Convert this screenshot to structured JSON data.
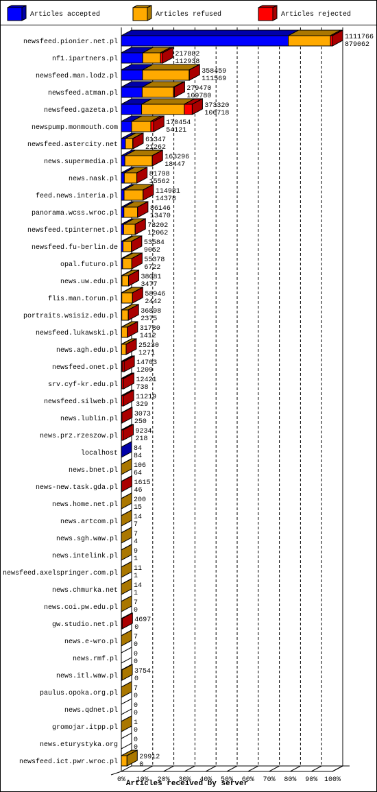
{
  "chart_data": {
    "type": "bar",
    "orientation": "horizontal-stacked-3d",
    "xlabel": "Articles received by server",
    "xticks": [
      "0%",
      "10%",
      "20%",
      "30%",
      "40%",
      "50%",
      "60%",
      "70%",
      "80%",
      "90%",
      "100%"
    ],
    "xlim": [
      0,
      100
    ],
    "grid": true,
    "legend_placement": "top",
    "legend": [
      {
        "name": "Articles accepted",
        "color": "#0000ff",
        "shade": "#0000a8"
      },
      {
        "name": "Articles refused",
        "color": "#ffaa00",
        "shade": "#aa7700"
      },
      {
        "name": "Articles rejected",
        "color": "#ff0000",
        "shade": "#aa0000"
      }
    ],
    "rows": [
      {
        "host": "newsfeed.pionier.net.pl",
        "total": 1111766,
        "accepted": 879062,
        "refused": 222000,
        "rejected": 10704
      },
      {
        "host": "nf1.ipartners.pl",
        "total": 217882,
        "accepted": 112938,
        "refused": 93000,
        "rejected": 11944
      },
      {
        "host": "newsfeed.man.lodz.pl",
        "total": 358459,
        "accepted": 111569,
        "refused": 245500,
        "rejected": 1390
      },
      {
        "host": "newsfeed.atman.pl",
        "total": 279470,
        "accepted": 109780,
        "refused": 165000,
        "rejected": 4690
      },
      {
        "host": "newsfeed.gazeta.pl",
        "total": 373320,
        "accepted": 106718,
        "refused": 225000,
        "rejected": 41602
      },
      {
        "host": "newspump.monmouth.com",
        "total": 170454,
        "accepted": 54121,
        "refused": 101000,
        "rejected": 15333
      },
      {
        "host": "newsfeed.astercity.net",
        "total": 61347,
        "accepted": 21262,
        "refused": 39000,
        "rejected": 1085
      },
      {
        "host": "news.supermedia.pl",
        "total": 163296,
        "accepted": 18447,
        "refused": 144000,
        "rejected": 849
      },
      {
        "host": "news.nask.pl",
        "total": 81798,
        "accepted": 15562,
        "refused": 66000,
        "rejected": 236
      },
      {
        "host": "feed.news.interia.pl",
        "total": 114981,
        "accepted": 14378,
        "refused": 100000,
        "rejected": 603
      },
      {
        "host": "panorama.wcss.wroc.pl",
        "total": 86146,
        "accepted": 13470,
        "refused": 72000,
        "rejected": 676
      },
      {
        "host": "newsfeed.tpinternet.pl",
        "total": 73202,
        "accepted": 12062,
        "refused": 61000,
        "rejected": 140
      },
      {
        "host": "newsfeed.fu-berlin.de",
        "total": 53584,
        "accepted": 9052,
        "refused": 44000,
        "rejected": 532
      },
      {
        "host": "opal.futuro.pl",
        "total": 55378,
        "accepted": 6722,
        "refused": 48500,
        "rejected": 156
      },
      {
        "host": "news.uw.edu.pl",
        "total": 38081,
        "accepted": 3477,
        "refused": 34500,
        "rejected": 104
      },
      {
        "host": "flis.man.torun.pl",
        "total": 58946,
        "accepted": 2442,
        "refused": 56400,
        "rejected": 104
      },
      {
        "host": "portraits.wsisiz.edu.pl",
        "total": 36898,
        "accepted": 2375,
        "refused": 34400,
        "rejected": 123
      },
      {
        "host": "newsfeed.lukawski.pl",
        "total": 31780,
        "accepted": 1412,
        "refused": 30300,
        "rejected": 68
      },
      {
        "host": "news.agh.edu.pl",
        "total": 25230,
        "accepted": 1271,
        "refused": 23900,
        "rejected": 59
      },
      {
        "host": "newsfeed.onet.pl",
        "total": 14703,
        "accepted": 1209,
        "refused": 3500,
        "rejected": 9994
      },
      {
        "host": "srv.cyf-kr.edu.pl",
        "total": 12421,
        "accepted": 738,
        "refused": 2000,
        "rejected": 9683
      },
      {
        "host": "newsfeed.silweb.pl",
        "total": 11219,
        "accepted": 329,
        "refused": 1200,
        "rejected": 9690
      },
      {
        "host": "news.lublin.pl",
        "total": 3073,
        "accepted": 250,
        "refused": 0,
        "rejected": 2823
      },
      {
        "host": "news.prz.rzeszow.pl",
        "total": 9234,
        "accepted": 218,
        "refused": 800,
        "rejected": 8216
      },
      {
        "host": "localhost",
        "total": 84,
        "accepted": 84,
        "refused": 0,
        "rejected": 0
      },
      {
        "host": "news.bnet.pl",
        "total": 106,
        "accepted": 64,
        "refused": 42,
        "rejected": 0
      },
      {
        "host": "news-new.task.gda.pl",
        "total": 1615,
        "accepted": 46,
        "refused": 0,
        "rejected": 1569
      },
      {
        "host": "news.home.net.pl",
        "total": 200,
        "accepted": 15,
        "refused": 185,
        "rejected": 0
      },
      {
        "host": "news.artcom.pl",
        "total": 14,
        "accepted": 7,
        "refused": 7,
        "rejected": 0
      },
      {
        "host": "news.sgh.waw.pl",
        "total": 7,
        "accepted": 4,
        "refused": 3,
        "rejected": 0
      },
      {
        "host": "news.intelink.pl",
        "total": 9,
        "accepted": 1,
        "refused": 8,
        "rejected": 0
      },
      {
        "host": "newsfeed.axelspringer.com.pl",
        "total": 11,
        "accepted": 1,
        "refused": 10,
        "rejected": 0
      },
      {
        "host": "news.chmurka.net",
        "total": 14,
        "accepted": 1,
        "refused": 13,
        "rejected": 0
      },
      {
        "host": "news.coi.pw.edu.pl",
        "total": 7,
        "accepted": 0,
        "refused": 7,
        "rejected": 0
      },
      {
        "host": "gw.studio.net.pl",
        "total": 4697,
        "accepted": 0,
        "refused": 0,
        "rejected": 4697
      },
      {
        "host": "news.e-wro.pl",
        "total": 7,
        "accepted": 0,
        "refused": 7,
        "rejected": 0
      },
      {
        "host": "news.rmf.pl",
        "total": 0,
        "accepted": 0,
        "refused": 0,
        "rejected": 0
      },
      {
        "host": "news.itl.waw.pl",
        "total": 3754,
        "accepted": 0,
        "refused": 3754,
        "rejected": 0
      },
      {
        "host": "paulus.opoka.org.pl",
        "total": 7,
        "accepted": 0,
        "refused": 7,
        "rejected": 0
      },
      {
        "host": "news.qdnet.pl",
        "total": 0,
        "accepted": 0,
        "refused": 0,
        "rejected": 0
      },
      {
        "host": "gromojar.itpp.pl",
        "total": 1,
        "accepted": 0,
        "refused": 1,
        "rejected": 0
      },
      {
        "host": "news.eturystyka.org",
        "total": 0,
        "accepted": 0,
        "refused": 0,
        "rejected": 0
      },
      {
        "host": "newsfeed.ict.pwr.wroc.pl",
        "total": 29912,
        "accepted": 0,
        "refused": 29912,
        "rejected": 0
      }
    ]
  }
}
